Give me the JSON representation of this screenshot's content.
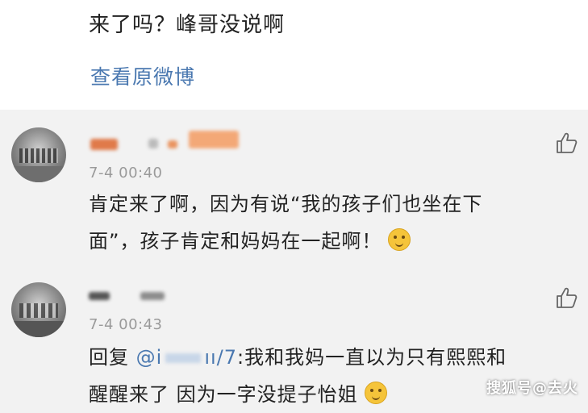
{
  "post": {
    "text": "来了吗？峰哥没说啊",
    "view_original": "查看原微博"
  },
  "comments": [
    {
      "timestamp": "7-4 00:40",
      "line1": "肯定来了啊，因为有说“我的孩子们也坐在下",
      "line2": "面”，孩子肯定和妈妈在一起啊！",
      "emoji_icon": "tongue-out-emoji-icon",
      "like_icon": "thumbs-up-icon"
    },
    {
      "timestamp": "7-4 00:43",
      "reply_prefix": "回复 ",
      "mention_start": "@ⅰ",
      "mention_end": "ıı/7",
      "line1_rest": ":我和我妈一直以为只有熙熙和",
      "line2": "醒醒来了 因为一字没提子怡姐",
      "emoji_icon": "laughing-tears-emoji-icon",
      "like_icon": "thumbs-up-icon"
    }
  ],
  "watermark": "搜狐号@去火",
  "colors": {
    "link": "#4a78b0",
    "timestamp": "#9a9a9a",
    "background": "#f2f2f2"
  }
}
